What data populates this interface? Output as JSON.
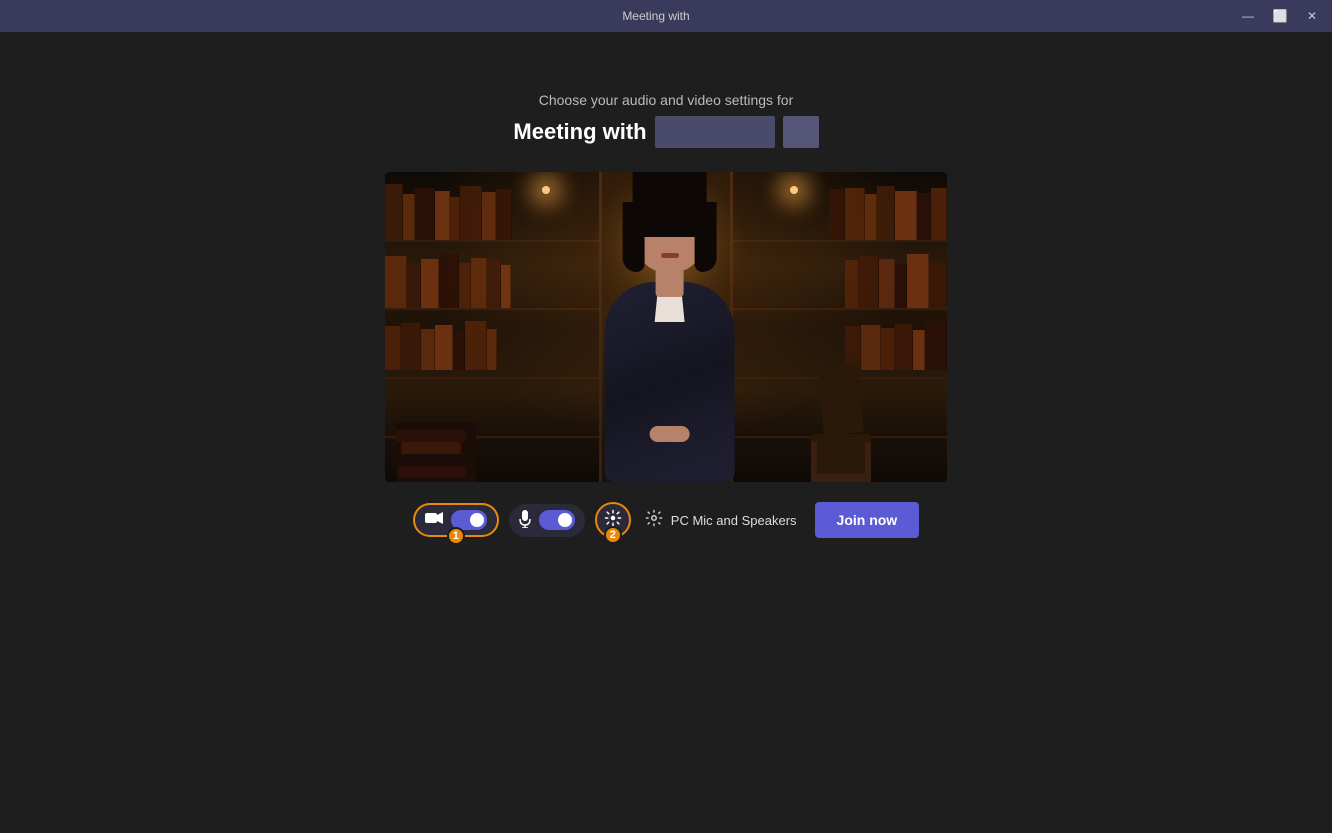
{
  "titlebar": {
    "title": "Meeting with",
    "minimize_label": "—",
    "restore_label": "⬜",
    "close_label": "✕"
  },
  "header": {
    "subtitle": "Choose your audio and video settings for",
    "meeting_title": "Meeting with"
  },
  "controls": {
    "video_toggle_on": true,
    "mic_toggle_on": true,
    "video_badge": "1",
    "effects_badge": "2",
    "audio_label": "PC Mic and Speakers",
    "join_button": "Join now"
  },
  "badges": {
    "video": "1",
    "effects": "2"
  }
}
